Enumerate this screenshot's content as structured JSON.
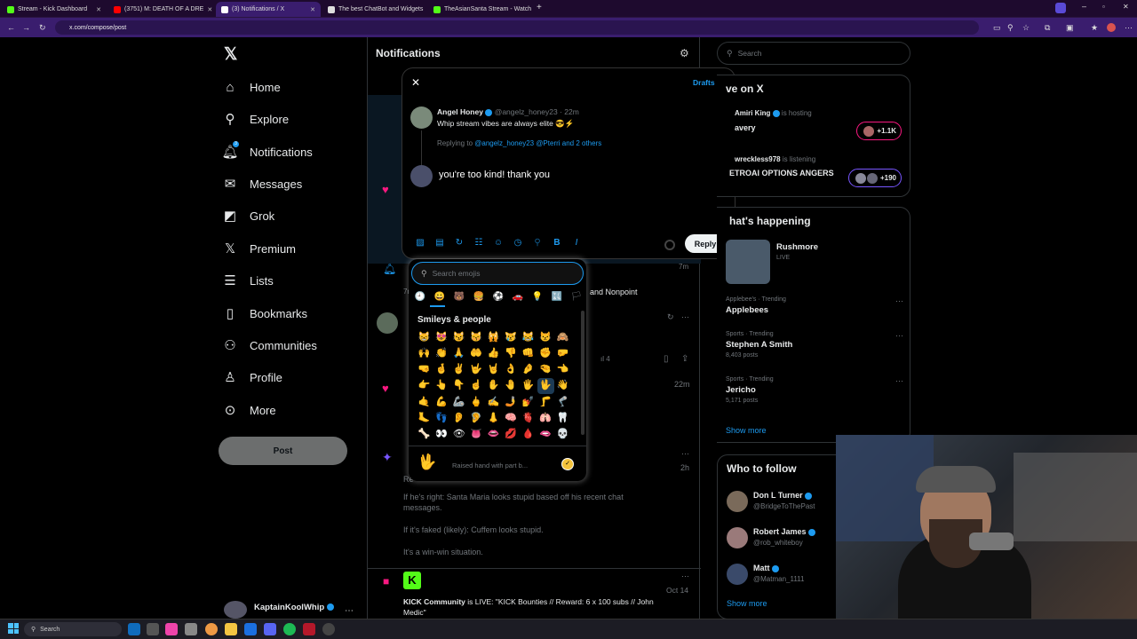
{
  "browser": {
    "tabs": [
      {
        "label": "Stream - Kick Dashboard",
        "color": "#53fc18"
      },
      {
        "label": "(3751) M: DEATH OF A DRE",
        "color": "#ff0000"
      },
      {
        "label": "(3) Notifications / X",
        "color": "#ffffff"
      },
      {
        "label": "The best ChatBot and Widgets",
        "color": "#ffffff"
      },
      {
        "label": "TheAsianSanta Stream - Watch",
        "color": "#53fc18"
      }
    ],
    "url": "x.com/compose/post"
  },
  "sidebar": {
    "items": [
      {
        "label": "Home",
        "icon": "home-icon",
        "glyph": "⌂"
      },
      {
        "label": "Explore",
        "icon": "search-icon",
        "glyph": "⚲"
      },
      {
        "label": "Notifications",
        "icon": "bell-icon",
        "glyph": "🔔︎",
        "badge": "3"
      },
      {
        "label": "Messages",
        "icon": "mail-icon",
        "glyph": "✉"
      },
      {
        "label": "Grok",
        "icon": "grok-icon",
        "glyph": "◩"
      },
      {
        "label": "Premium",
        "icon": "x-logo-icon",
        "glyph": "𝕏"
      },
      {
        "label": "Lists",
        "icon": "list-icon",
        "glyph": "☰"
      },
      {
        "label": "Bookmarks",
        "icon": "bookmark-icon",
        "glyph": "▯"
      },
      {
        "label": "Communities",
        "icon": "people-icon",
        "glyph": "⚇"
      },
      {
        "label": "Profile",
        "icon": "person-icon",
        "glyph": "♙"
      },
      {
        "label": "More",
        "icon": "more-icon",
        "glyph": "⊙"
      }
    ],
    "post_label": "Post",
    "account_name": "KaptainKoolWhip"
  },
  "center": {
    "title": "Notifications",
    "row_nonpoint": "and Nonpoint",
    "row_7m": "7m",
    "row_22m": "22m",
    "row_2h": "2h",
    "views": "4",
    "quote_lines": [
      "If he's right: Santa Maria looks stupid based off his recent chat messages.",
      "If it's faked (likely): Cuffem looks stupid.",
      "It's a win-win situation."
    ],
    "kick_name": "KICK Community",
    "kick_text": " is LIVE: \"KICK Bounties // Reward: 6 x 100 subs // John Medic\"",
    "kick_date": "Oct 14",
    "partial": "Re"
  },
  "compose": {
    "drafts": "Drafts",
    "author": "Angel Honey",
    "handle": "@angelz_honey23",
    "time": "· 22m",
    "tweet": "Whip stream vibes are always elite 😎⚡",
    "replying_prefix": "Replying to ",
    "replying_to": "@angelz_honey23 @Pterri and 2 others",
    "reply_text": "you're too kind! thank you",
    "reply_button": "Reply"
  },
  "emoji": {
    "search_placeholder": "Search emojis",
    "section": "Smileys & people",
    "preview_name": "Raised hand with part b...",
    "preview_glyph": "🖖",
    "categories": [
      "🕘",
      "😀",
      "🐻",
      "🍔",
      "⚽",
      "🚗",
      "💡",
      "🔣",
      "🏳"
    ],
    "grid": [
      "😸",
      "😻",
      "😼",
      "😽",
      "🙀",
      "😿",
      "😹",
      "😾",
      "🙈",
      "🙌",
      "👏",
      "🙏",
      "🤲",
      "👍",
      "👎",
      "👊",
      "✊",
      "🤛",
      "🤜",
      "🤞",
      "✌",
      "🤟",
      "🤘",
      "👌",
      "🤌",
      "🤏",
      "👈",
      "👉",
      "👆",
      "👇",
      "☝",
      "✋",
      "🤚",
      "🖐",
      "🖖",
      "👋",
      "🤙",
      "💪",
      "🦾",
      "🖕",
      "✍",
      "🤳",
      "💅",
      "🦵",
      "🦿",
      "🦶",
      "👣",
      "👂",
      "🦻",
      "👃",
      "🧠",
      "🫀",
      "🫁",
      "🦷",
      "🦴",
      "👀",
      "👁",
      "👅",
      "👄",
      "💋",
      "🩸",
      "🫦",
      "💀"
    ]
  },
  "right": {
    "search_placeholder": "Search",
    "live_title": "ve on X",
    "live": [
      {
        "name": "Amiri King",
        "status": "is hosting",
        "title": "avery",
        "count": "+1.1K"
      },
      {
        "name": "wreckless978",
        "status": "is listening",
        "title": "ETROAI OPTIONS ANGERS",
        "count": "+190"
      }
    ],
    "happening_title": "hat's happening",
    "rushmore": "Rushmore",
    "rushmore_live": "LIVE",
    "trends": [
      {
        "meta": "Applebee's · Trending",
        "title": "Applebees",
        "posts": ""
      },
      {
        "meta": "Sports · Trending",
        "title": "Stephen A Smith",
        "posts": "8,403 posts"
      },
      {
        "meta": "Sports · Trending",
        "title": "Jericho",
        "posts": "5,171 posts"
      }
    ],
    "show_more": "Show more",
    "follow_title": "Who to follow",
    "follow": [
      {
        "name": "Don L Turner",
        "handle": "@BridgeToThePast"
      },
      {
        "name": "Robert James",
        "handle": "@rob_whiteboy"
      },
      {
        "name": "Matt",
        "handle": "@Matman_1111"
      }
    ],
    "show_more2": "Show more"
  },
  "taskbar": {
    "search": "Search"
  },
  "colors": {
    "accent": "#1d9bf0",
    "browser_chrome": "#3a1d6e",
    "bg": "#000000"
  }
}
